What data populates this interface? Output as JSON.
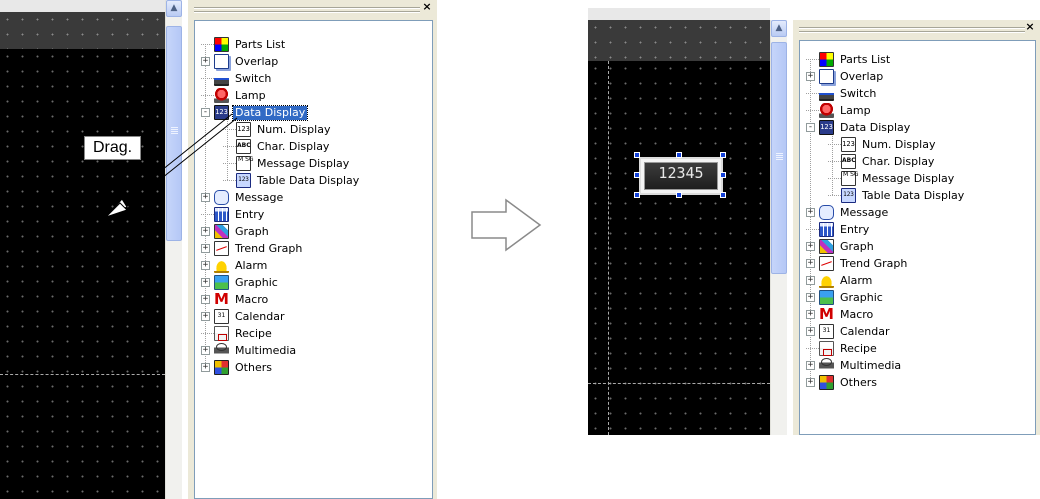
{
  "annotations": {
    "drag_label": "Drag."
  },
  "tree": {
    "items": [
      {
        "label": "Parts List",
        "icon": "parts-list-icon",
        "expander": "none",
        "level": 0
      },
      {
        "label": "Overlap",
        "icon": "overlap-icon",
        "expander": "+",
        "level": 0
      },
      {
        "label": "Switch",
        "icon": "switch-icon",
        "expander": "none",
        "level": 0
      },
      {
        "label": "Lamp",
        "icon": "lamp-icon",
        "expander": "none",
        "level": 0
      },
      {
        "label": "Data Display",
        "icon": "data-display-icon",
        "expander": "-",
        "level": 0
      },
      {
        "label": "Num. Display",
        "icon": "num-display-icon",
        "expander": "none",
        "level": 1
      },
      {
        "label": "Char. Display",
        "icon": "char-display-icon",
        "expander": "none",
        "level": 1
      },
      {
        "label": "Message Display",
        "icon": "message-display-icon",
        "expander": "none",
        "level": 1
      },
      {
        "label": "Table Data Display",
        "icon": "table-data-display-icon",
        "expander": "none",
        "level": 1
      },
      {
        "label": "Message",
        "icon": "message-icon",
        "expander": "+",
        "level": 0
      },
      {
        "label": "Entry",
        "icon": "entry-icon",
        "expander": "none",
        "level": 0
      },
      {
        "label": "Graph",
        "icon": "graph-icon",
        "expander": "+",
        "level": 0
      },
      {
        "label": "Trend Graph",
        "icon": "trend-graph-icon",
        "expander": "+",
        "level": 0
      },
      {
        "label": "Alarm",
        "icon": "alarm-icon",
        "expander": "+",
        "level": 0
      },
      {
        "label": "Graphic",
        "icon": "graphic-icon",
        "expander": "+",
        "level": 0
      },
      {
        "label": "Macro",
        "icon": "macro-icon",
        "expander": "+",
        "level": 0
      },
      {
        "label": "Calendar",
        "icon": "calendar-icon",
        "expander": "+",
        "level": 0
      },
      {
        "label": "Recipe",
        "icon": "recipe-icon",
        "expander": "none",
        "level": 0
      },
      {
        "label": "Multimedia",
        "icon": "multimedia-icon",
        "expander": "+",
        "level": 0
      },
      {
        "label": "Others",
        "icon": "others-icon",
        "expander": "+",
        "level": 0
      }
    ],
    "icon_glyphs": {
      "num": "123",
      "char": "ABC",
      "msg": "M SG",
      "table": "123",
      "data": "123",
      "calendar": "31",
      "macro": "M"
    },
    "selected_before": "Data Display"
  },
  "placed_part": {
    "value": "12345"
  },
  "close_glyph": "×",
  "scroll_up_glyph": "▲"
}
